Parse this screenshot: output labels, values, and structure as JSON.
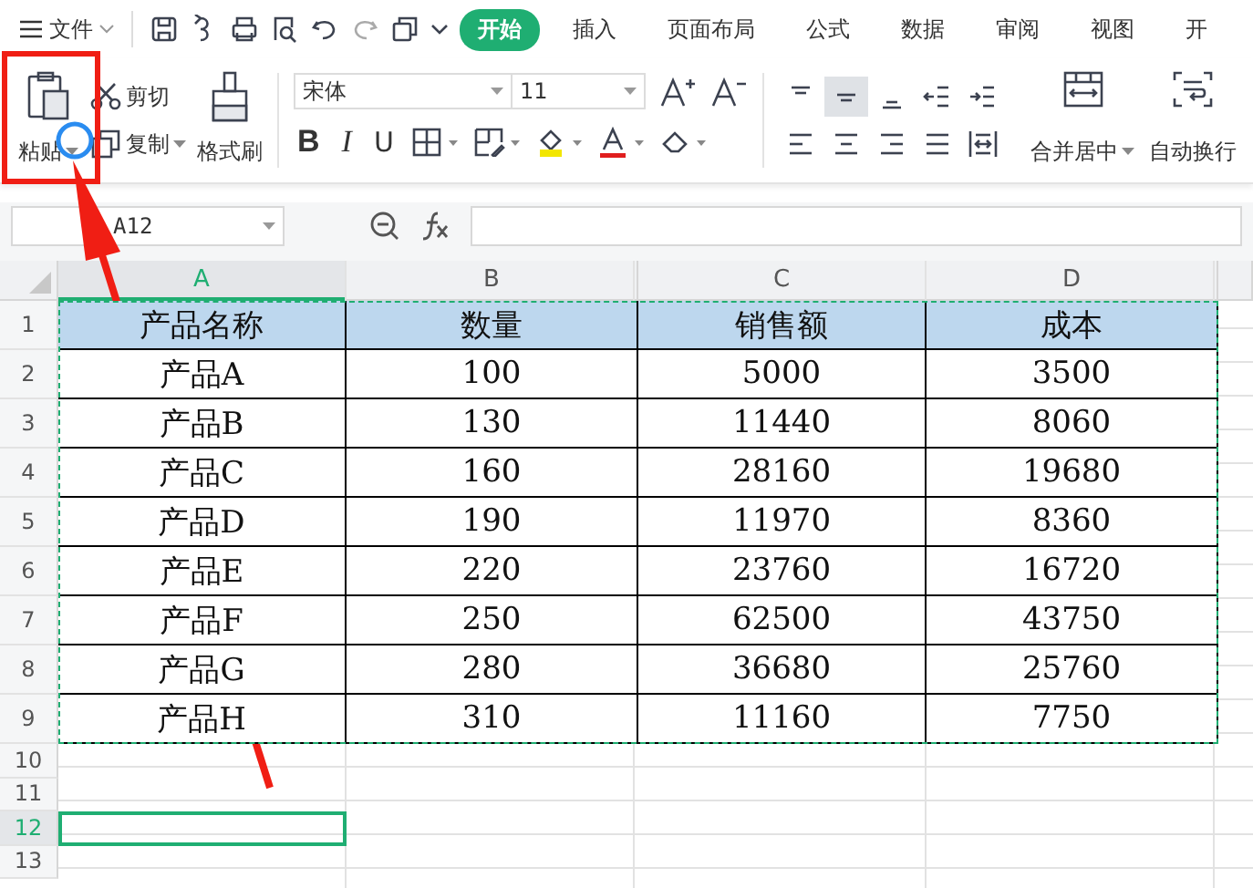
{
  "top_bar": {
    "menu": "文件",
    "tabs": [
      {
        "label": "开始",
        "selected": true
      },
      {
        "label": "插入",
        "selected": false
      },
      {
        "label": "页面布局",
        "selected": false
      },
      {
        "label": "公式",
        "selected": false
      },
      {
        "label": "数据",
        "selected": false
      },
      {
        "label": "审阅",
        "selected": false
      },
      {
        "label": "视图",
        "selected": false
      },
      {
        "label": "开",
        "selected": false
      }
    ]
  },
  "ribbon": {
    "paste": "粘贴",
    "cut": "剪切",
    "copy": "复制",
    "format_painter": "格式刷",
    "font": "宋体",
    "font_size": "11",
    "bold": "B",
    "italic": "I",
    "underline": "U",
    "merge": "合并居中",
    "wrap": "自动换行",
    "align_buttons": [
      {
        "kind": "top",
        "selected": false
      },
      {
        "kind": "middle",
        "selected": true
      },
      {
        "kind": "bottom",
        "selected": false
      },
      {
        "kind": "outdent",
        "selected": false
      },
      {
        "kind": "indent",
        "selected": false
      },
      {
        "kind": "left",
        "selected": false
      },
      {
        "kind": "center",
        "selected": false
      },
      {
        "kind": "right",
        "selected": false
      },
      {
        "kind": "justify",
        "selected": false
      },
      {
        "kind": "distributed",
        "selected": false
      }
    ]
  },
  "formula_bar": {
    "name_box": "A12"
  },
  "sheet": {
    "columns": [
      {
        "label": "A",
        "selected": true
      },
      {
        "label": "B",
        "selected": false
      },
      {
        "label": "C",
        "selected": false
      },
      {
        "label": "D",
        "selected": false
      }
    ],
    "rows": [
      {
        "number": "1",
        "kind": "header",
        "selected": false,
        "cells": [
          "产品名称",
          "数量",
          "销售额",
          "成本"
        ]
      },
      {
        "number": "2",
        "kind": "data",
        "selected": false,
        "cells": [
          "产品A",
          "100",
          "5000",
          "3500"
        ]
      },
      {
        "number": "3",
        "kind": "data",
        "selected": false,
        "cells": [
          "产品B",
          "130",
          "11440",
          "8060"
        ]
      },
      {
        "number": "4",
        "kind": "data",
        "selected": false,
        "cells": [
          "产品C",
          "160",
          "28160",
          "19680"
        ]
      },
      {
        "number": "5",
        "kind": "data",
        "selected": false,
        "cells": [
          "产品D",
          "190",
          "11970",
          "8360"
        ]
      },
      {
        "number": "6",
        "kind": "data",
        "selected": false,
        "cells": [
          "产品E",
          "220",
          "23760",
          "16720"
        ]
      },
      {
        "number": "7",
        "kind": "data",
        "selected": false,
        "cells": [
          "产品F",
          "250",
          "62500",
          "43750"
        ]
      },
      {
        "number": "8",
        "kind": "data",
        "selected": false,
        "cells": [
          "产品G",
          "280",
          "36680",
          "25760"
        ]
      },
      {
        "number": "9",
        "kind": "data",
        "selected": false,
        "cells": [
          "产品H",
          "310",
          "11160",
          "7750"
        ]
      },
      {
        "number": "10",
        "kind": "empty",
        "selected": false
      },
      {
        "number": "11",
        "kind": "empty",
        "selected": false
      },
      {
        "number": "12",
        "kind": "empty",
        "selected": true
      },
      {
        "number": "13",
        "kind": "empty",
        "selected": false
      }
    ]
  }
}
